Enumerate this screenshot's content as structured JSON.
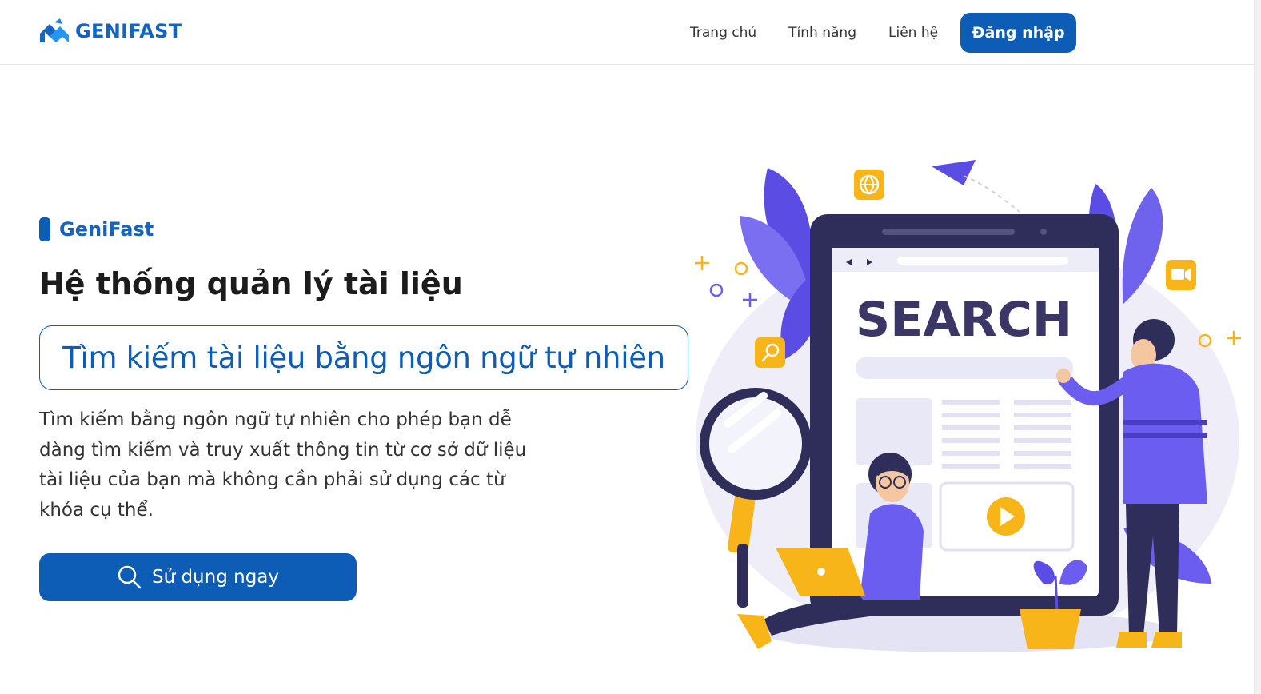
{
  "brand": {
    "name": "GENIFAST"
  },
  "nav": {
    "items": [
      {
        "label": "Trang chủ"
      },
      {
        "label": "Tính năng"
      },
      {
        "label": "Liên hệ"
      }
    ],
    "login_label": "Đăng nhập"
  },
  "hero": {
    "tag": "GeniFast",
    "title": "Hệ thống quản lý tài liệu",
    "highlight": "Tìm kiếm tài liệu bằng ngôn ngữ tự nhiên",
    "description": "Tìm kiếm bằng ngôn ngữ tự nhiên cho phép bạn dễ dàng tìm kiếm và truy xuất thông tin từ cơ sở dữ liệu tài liệu của bạn mà không cần phải sử dụng các từ khóa cụ thể.",
    "cta_label": "Sử dụng ngay",
    "cta_icon": "search-icon"
  },
  "illustration": {
    "screen_word": "SEARCH"
  },
  "colors": {
    "primary": "#0d5cb6",
    "accent_purple": "#6a5df0",
    "accent_yellow": "#f7b519",
    "dark_navy": "#2d2b57"
  }
}
